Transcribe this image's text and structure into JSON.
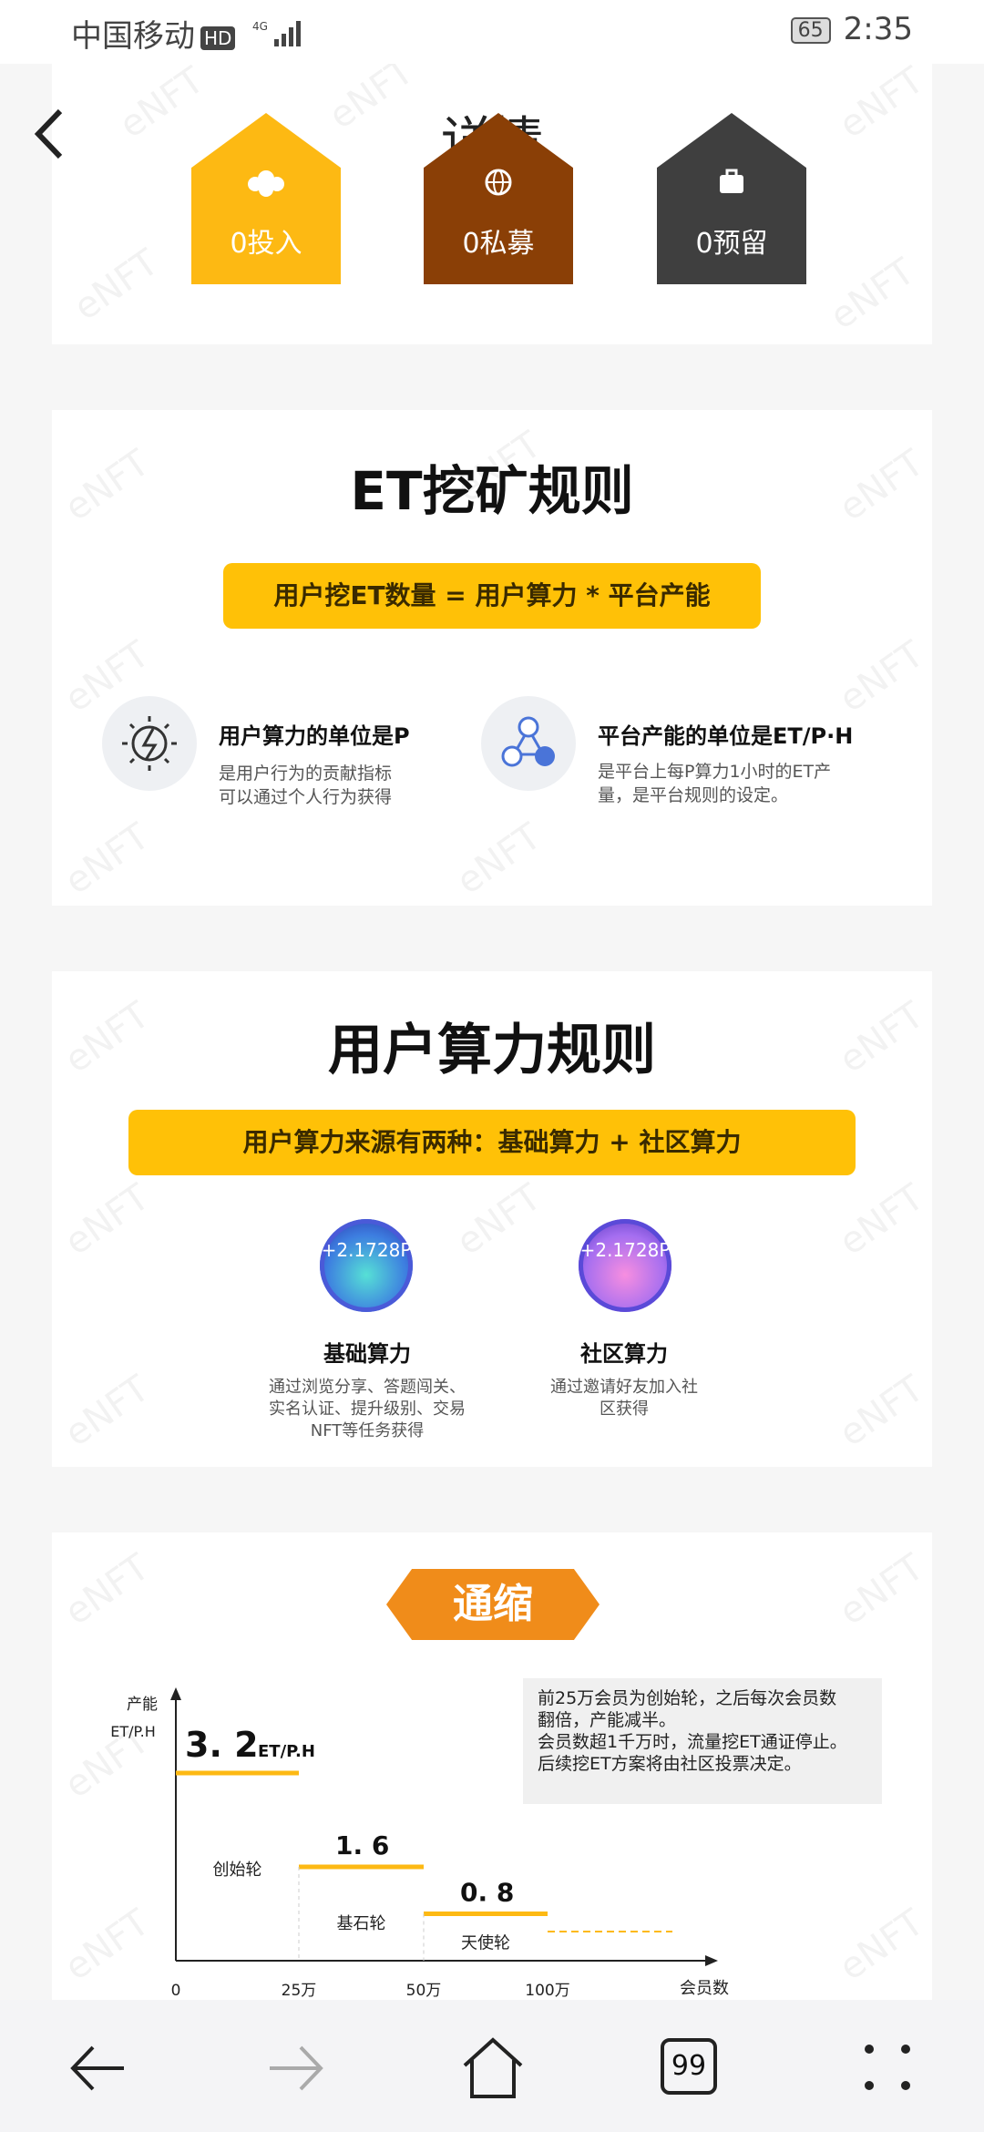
{
  "status_bar": {
    "carrier": "中国移动",
    "hd": "HD",
    "network": "4G",
    "battery": "65",
    "time": "2:35"
  },
  "header": {
    "title": "详情"
  },
  "top_houses": [
    {
      "label": "0投入",
      "icon": "coins-icon",
      "color": "#fdb913"
    },
    {
      "label": "0私募",
      "icon": "globe-icon",
      "color": "#8a3f06"
    },
    {
      "label": "0预留",
      "icon": "briefcase-icon",
      "color": "#3f3f3f"
    }
  ],
  "watermark": "eNFT",
  "mining": {
    "title": "ET挖矿规则",
    "formula": "用户挖ET数量 = 用户算力 * 平台产能",
    "items": [
      {
        "title": "用户算力的单位是P",
        "desc_line1": "是用户行为的贡献指标",
        "desc_line2": "可以通过个人行为获得"
      },
      {
        "title": "平台产能的单位是ET/P·H",
        "desc_line1": "是平台上每P算力1小时的ET产",
        "desc_line2": "量，是平台规则的设定。"
      }
    ]
  },
  "power": {
    "title": "用户算力规则",
    "banner": "用户算力来源有两种：基础算力 + 社区算力",
    "items": [
      {
        "badge": "+2.1728P",
        "title": "基础算力",
        "desc_line1": "通过浏览分享、答题闯关、",
        "desc_line2": "实名认证、提升级别、交易",
        "desc_line3": "NFT等任务获得"
      },
      {
        "badge": "+2.1728P",
        "title": "社区算力",
        "desc_line1": "通过邀请好友加入社",
        "desc_line2": "区获得",
        "desc_line3": ""
      }
    ]
  },
  "deflation": {
    "title": "通缩",
    "note_lines": [
      "前25万会员为创始轮，之后每次会员数",
      "翻倍，产能减半。",
      "会员数超1千万时，流量挖ET通证停止。",
      "后续挖ET方案将由社区投票决定。"
    ]
  },
  "chart_data": {
    "type": "line",
    "ylabel_line1": "产能",
    "ylabel_line2": "ET/P.H",
    "xlabel": "会员数",
    "x_ticks": [
      "0",
      "25万",
      "50万",
      "100万"
    ],
    "steps": [
      {
        "from": "0",
        "to": "25万",
        "value": 3.2,
        "value_label": "3. 2",
        "unit": "ET/P.H",
        "round": "创始轮"
      },
      {
        "from": "25万",
        "to": "50万",
        "value": 1.6,
        "value_label": "1. 6",
        "round": "基石轮"
      },
      {
        "from": "50万",
        "to": "100万",
        "value": 0.8,
        "value_label": "0. 8",
        "round": "天使轮"
      }
    ],
    "continuation": "dashed",
    "line_color": "#fdb913"
  },
  "nav": {
    "tabs_count": "99"
  }
}
